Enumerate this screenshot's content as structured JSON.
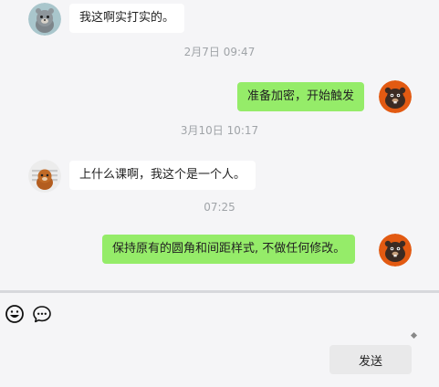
{
  "chat": {
    "messages": [
      {
        "side": "in",
        "text": "我这啊实打实的。"
      },
      {
        "side": "out",
        "text": "准备加密，开始触发"
      },
      {
        "side": "in",
        "text": "上什么课啊，我这个是一个人。"
      },
      {
        "side": "out",
        "text": "保持原有的圆角和间距样式, 不做任何修改。"
      }
    ],
    "timestamps": [
      "2月7日 09:47",
      "3月10日 10:17",
      "07:25"
    ]
  },
  "toolbar": {
    "emoji_icon": "smiley-icon",
    "more_icon": "chat-bubble-dots-icon"
  },
  "composer": {
    "send_label": "发送"
  },
  "colors": {
    "outgoing_bubble": "#95ec69",
    "incoming_bubble": "#ffffff",
    "timestamp": "#a0a4a8",
    "background": "#f5f5f7"
  }
}
